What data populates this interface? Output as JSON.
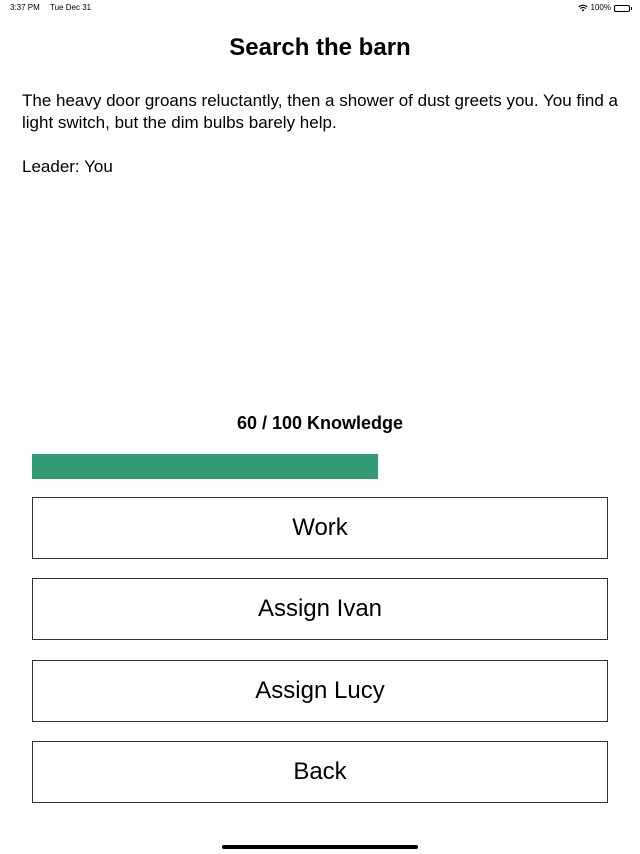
{
  "status_bar": {
    "time": "3:37 PM",
    "date": "Tue Dec 31",
    "battery_text": "100%",
    "icons": [
      "wifi-icon",
      "battery-icon"
    ]
  },
  "scene": {
    "title": "Search the barn",
    "description": "The heavy door groans reluctantly, then a shower of dust greets you. You find a light switch, but the dim bulbs barely help.",
    "leader_label": "Leader:",
    "leader_value": "You"
  },
  "progress": {
    "label": "60 / 100 Knowledge",
    "current": 60,
    "max": 100,
    "fill_color": "#339b73"
  },
  "actions": {
    "work": "Work",
    "assign_ivan": "Assign Ivan",
    "assign_lucy": "Assign Lucy",
    "back": "Back"
  }
}
